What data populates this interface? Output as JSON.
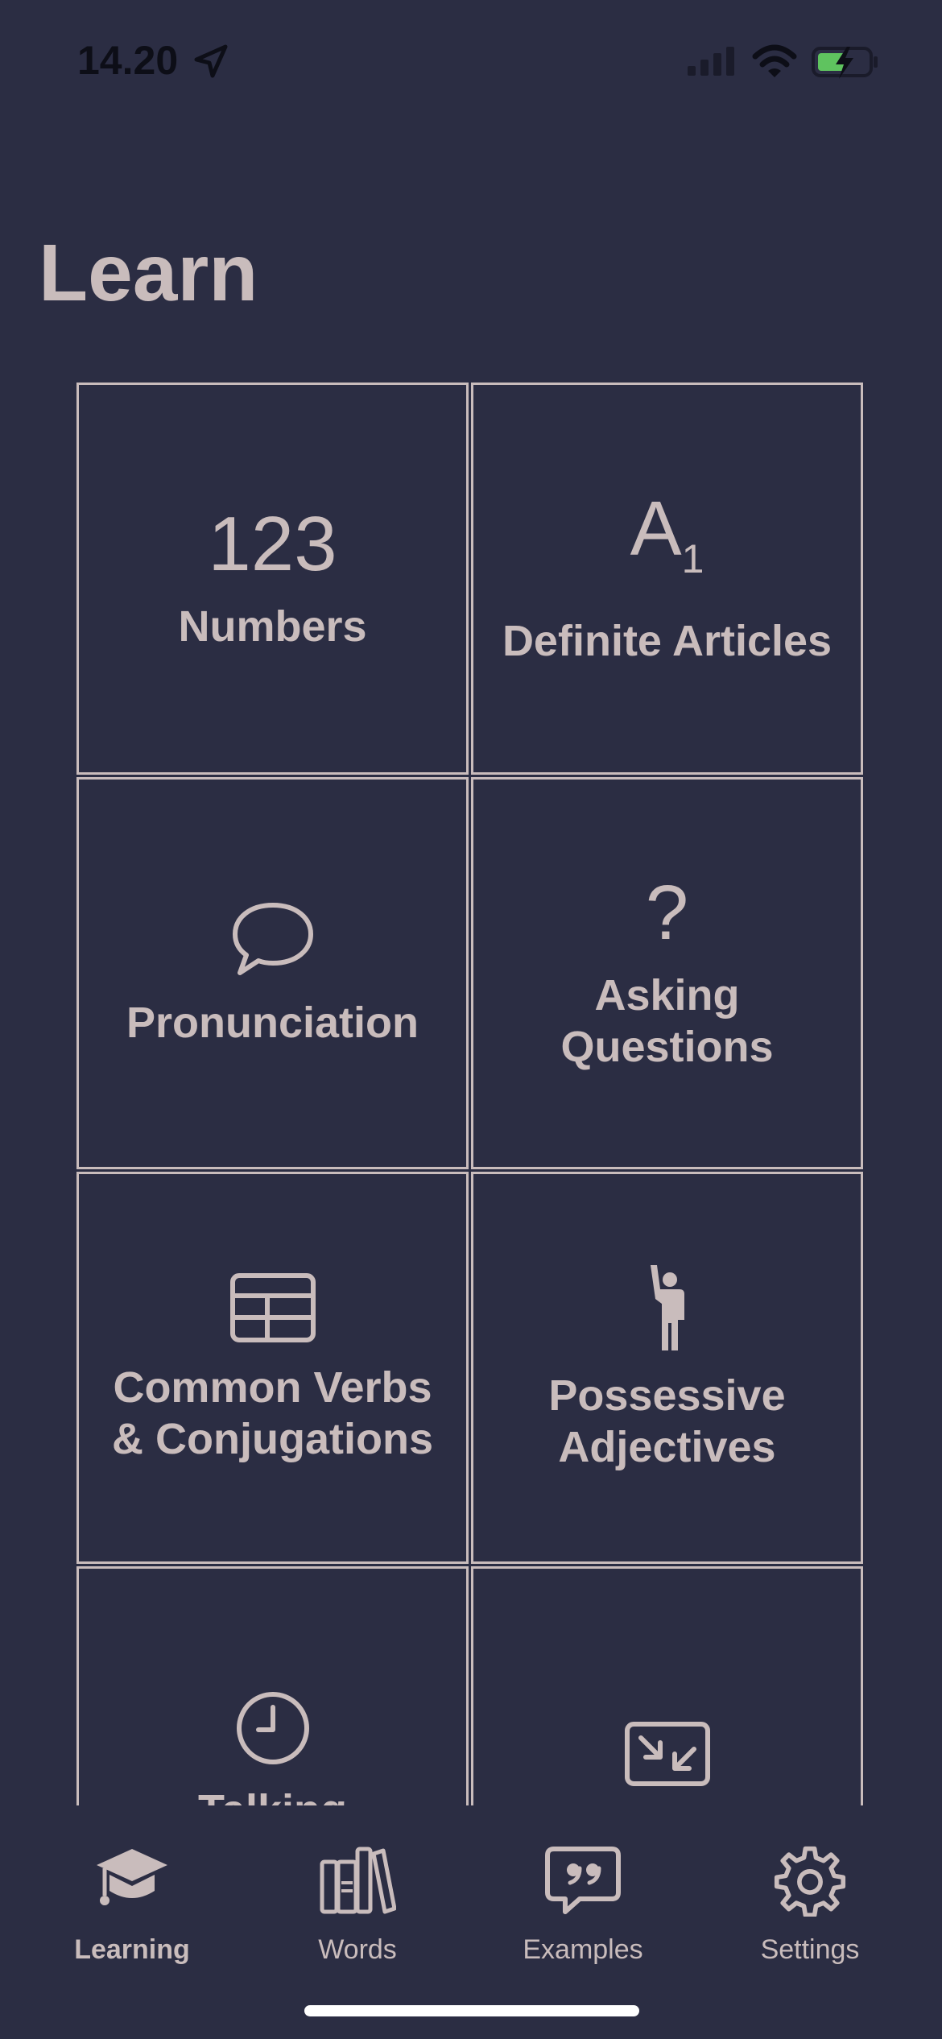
{
  "status_bar": {
    "time": "14.20"
  },
  "page": {
    "title": "Learn"
  },
  "cards": [
    {
      "icon": "numbers-glyph",
      "glyph": "123",
      "label": "Numbers"
    },
    {
      "icon": "a1-glyph",
      "glyph": "A",
      "glyph_sub": "1",
      "label": "Definite Articles"
    },
    {
      "icon": "speech-bubble-icon",
      "label": "Pronunciation"
    },
    {
      "icon": "question-mark-glyph",
      "glyph": "?",
      "label": "Asking\nQuestions"
    },
    {
      "icon": "table-icon",
      "label": "Common Verbs\n& Conjugations"
    },
    {
      "icon": "person-raising-hand-icon",
      "label": "Possessive\nAdjectives"
    },
    {
      "icon": "clock-icon",
      "label": "Talking"
    },
    {
      "icon": "arrows-in-frame-icon",
      "label": ""
    }
  ],
  "tabs": [
    {
      "icon": "graduation-cap-icon",
      "label": "Learning",
      "active": true
    },
    {
      "icon": "books-icon",
      "label": "Words",
      "active": false
    },
    {
      "icon": "quote-bubble-icon",
      "label": "Examples",
      "active": false
    },
    {
      "icon": "gear-icon",
      "label": "Settings",
      "active": false
    }
  ],
  "colors": {
    "background": "#2b2d43",
    "foreground": "#c9bcbc",
    "status_text": "#0d0e17",
    "battery_green": "#5fc35f"
  }
}
